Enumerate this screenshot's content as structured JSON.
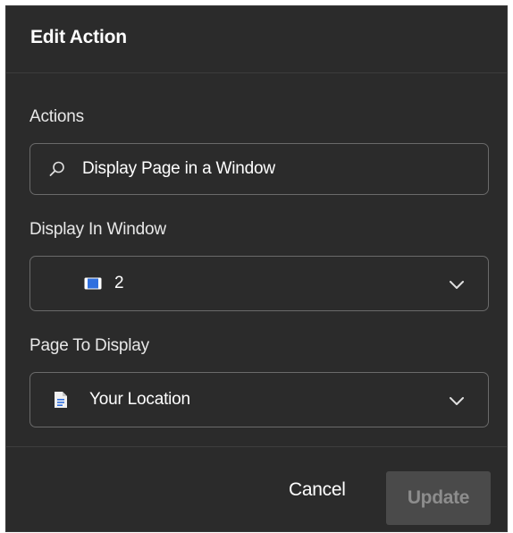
{
  "dialog": {
    "title": "Edit Action"
  },
  "actions": {
    "label": "Actions",
    "value": "Display Page in a Window",
    "icon": "search-icon"
  },
  "display_in_window": {
    "label": "Display In Window",
    "value": "2",
    "icon": "window-icon",
    "accent": "#2f6fdf"
  },
  "page_to_display": {
    "label": "Page To Display",
    "value": "Your Location",
    "icon": "page-icon"
  },
  "footer": {
    "cancel_label": "Cancel",
    "update_label": "Update"
  },
  "colors": {
    "background": "#2b2b2b",
    "border": "#6a6a6a",
    "update_bg": "#4a4a4a",
    "update_text": "#8d8d8d"
  }
}
